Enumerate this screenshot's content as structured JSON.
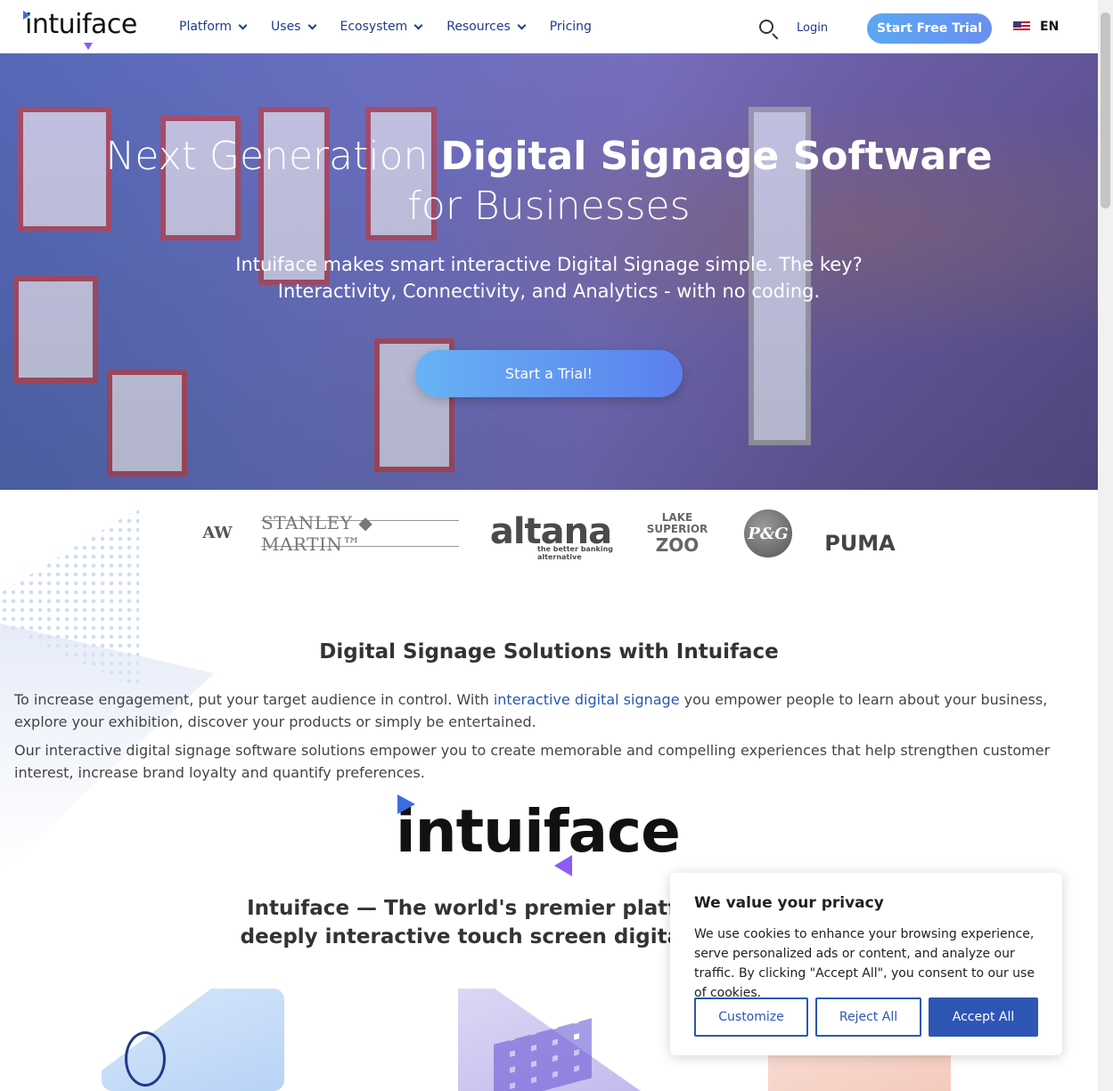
{
  "header": {
    "logo": "intuiface",
    "nav": [
      {
        "label": "Platform",
        "has_dropdown": true
      },
      {
        "label": "Uses",
        "has_dropdown": true
      },
      {
        "label": "Ecosystem",
        "has_dropdown": true
      },
      {
        "label": "Resources",
        "has_dropdown": true
      },
      {
        "label": "Pricing",
        "has_dropdown": false
      }
    ],
    "login": "Login",
    "cta": "Start Free Trial",
    "language": "EN"
  },
  "hero": {
    "title_light": "Next Generation ",
    "title_bold": "Digital Signage Software",
    "title_line2": "for Businesses",
    "subtitle_line1": "Intuiface makes smart interactive Digital Signage simple. The key?",
    "subtitle_line2": "Interactivity, Connectivity, and Analytics - with no coding.",
    "cta": "Start a Trial!"
  },
  "clients": {
    "aw": "AW",
    "stanley": "STANLEY ◆ MARTIN™",
    "altana": "altana",
    "altana_tag": "the better banking alternative",
    "zoo_line1": "LAKE",
    "zoo_line2": "SUPERIOR",
    "zoo_line3": "ZOO",
    "pg": "P&G",
    "puma": "PUMA"
  },
  "content": {
    "section_title": "Digital Signage Solutions with Intuiface",
    "p1_before": "To increase engagement, put your target audience in control. With ",
    "p1_link": "interactive digital signage",
    "p1_after": " you empower people to learn about your business, explore your exhibition, discover your products or simply be entertained.",
    "p2": "Our interactive digital signage software solutions empower you to create memorable and compelling experiences that help strengthen customer interest, increase brand loyalty and quantify preferences.",
    "big_logo": "intuiface",
    "premier_line1": "Intuiface — The world's premier platform for creatin",
    "premier_line2": "deeply interactive touch screen digital signage witho"
  },
  "cookie": {
    "title": "We value your privacy",
    "text": "We use cookies to enhance your browsing experience, serve personalized ads or content, and analyze our traffic. By clicking \"Accept All\", you consent to our use of cookies.",
    "customize": "Customize",
    "reject": "Reject All",
    "accept": "Accept All"
  },
  "colors": {
    "nav_text": "#1f3a8a",
    "cta_gradient_start": "#5aa8f2",
    "cta_gradient_end": "#6a8ff0",
    "link": "#2557b5",
    "cookie_button": "#2e56b4"
  },
  "icons": [
    "search-icon",
    "us-flag-icon",
    "chevron-down-icon"
  ]
}
